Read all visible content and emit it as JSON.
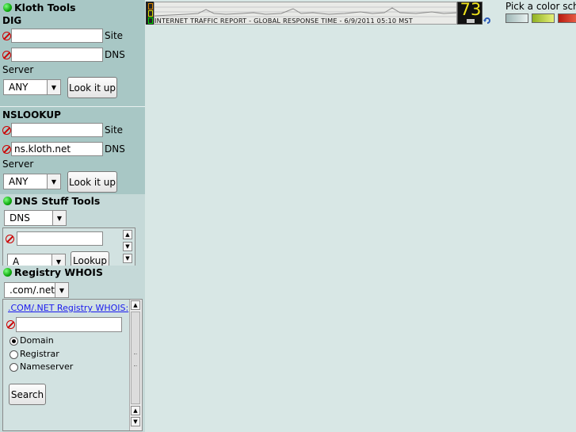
{
  "kloth": {
    "title": "Kloth Tools"
  },
  "dig": {
    "title": "DIG",
    "site_label": "Site",
    "site_value": "",
    "dns_label": "DNS",
    "dns_value": "",
    "server_label": "Server",
    "server_select": "ANY",
    "lookup_button": "Look it up"
  },
  "nslookup": {
    "title": "NSLOOKUP",
    "site_label": "Site",
    "site_value": "",
    "dns_label": "DNS",
    "dns_value": "ns.kloth.net",
    "server_label": "Server",
    "server_select": "ANY",
    "lookup_button": "Look it up"
  },
  "dnsstuff": {
    "title": "DNS Stuff Tools",
    "tool_select": "DNS",
    "query_value": "",
    "type_select": "A",
    "lookup_button": "Lookup"
  },
  "whois": {
    "title": "Registry WHOIS",
    "tld_select": ".com/.net",
    "link": ".COM/.NET Registry WHOIS:",
    "query_value": "",
    "options": [
      "Domain",
      "Registrar",
      "Nameserver"
    ],
    "selected_option": "Domain",
    "search_button": "Search"
  },
  "traffic": {
    "caption": "INTERNET TRAFFIC REPORT - GLOBAL RESPONSE TIME - 6/9/2011 05:10 MST",
    "index": "73"
  },
  "colors": {
    "label": "Pick a color sch",
    "swatches": [
      "#cfdedd",
      "#b7d33a",
      "#d23a2a"
    ]
  }
}
